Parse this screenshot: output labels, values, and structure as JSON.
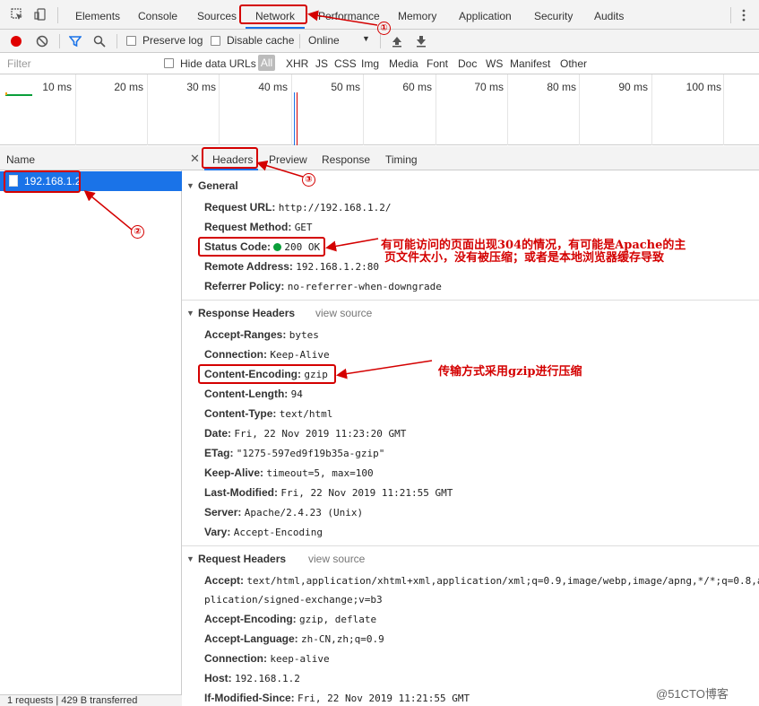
{
  "top_tabs": [
    "Elements",
    "Console",
    "Sources",
    "Network",
    "Performance",
    "Memory",
    "Application",
    "Security",
    "Audits"
  ],
  "toolbar": {
    "preserve_log": "Preserve log",
    "disable_cache": "Disable cache",
    "throttle": "Online"
  },
  "filter": {
    "placeholder": "Filter",
    "hide_data_urls": "Hide data URLs",
    "all": "All",
    "types": [
      "XHR",
      "JS",
      "CSS",
      "Img",
      "Media",
      "Font",
      "Doc",
      "WS",
      "Manifest",
      "Other"
    ]
  },
  "timeline": {
    "ticks": [
      "10 ms",
      "20 ms",
      "30 ms",
      "40 ms",
      "50 ms",
      "60 ms",
      "70 ms",
      "80 ms",
      "90 ms",
      "100 ms"
    ]
  },
  "requests": {
    "header": "Name",
    "items": [
      "192.168.1.2"
    ],
    "status": "1 requests | 429 B transferred"
  },
  "detail_tabs": [
    "Headers",
    "Preview",
    "Response",
    "Timing"
  ],
  "general": {
    "title": "General",
    "rows": [
      {
        "key": "Request URL:",
        "value": "http://192.168.1.2/"
      },
      {
        "key": "Request Method:",
        "value": "GET"
      },
      {
        "key": "Status Code:",
        "value": "200 OK"
      },
      {
        "key": "Remote Address:",
        "value": "192.168.1.2:80"
      },
      {
        "key": "Referrer Policy:",
        "value": "no-referrer-when-downgrade"
      }
    ]
  },
  "response_headers": {
    "title": "Response Headers",
    "view_source": "view source",
    "rows": [
      {
        "key": "Accept-Ranges:",
        "value": "bytes"
      },
      {
        "key": "Connection:",
        "value": "Keep-Alive"
      },
      {
        "key": "Content-Encoding:",
        "value": "gzip"
      },
      {
        "key": "Content-Length:",
        "value": "94"
      },
      {
        "key": "Content-Type:",
        "value": "text/html"
      },
      {
        "key": "Date:",
        "value": "Fri, 22 Nov 2019 11:23:20 GMT"
      },
      {
        "key": "ETag:",
        "value": "\"1275-597ed9f19b35a-gzip\""
      },
      {
        "key": "Keep-Alive:",
        "value": "timeout=5, max=100"
      },
      {
        "key": "Last-Modified:",
        "value": "Fri, 22 Nov 2019 11:21:55 GMT"
      },
      {
        "key": "Server:",
        "value": "Apache/2.4.23 (Unix)"
      },
      {
        "key": "Vary:",
        "value": "Accept-Encoding"
      }
    ]
  },
  "request_headers": {
    "title": "Request Headers",
    "view_source": "view source",
    "accept_key": "Accept:",
    "accept_value_1": "text/html,application/xhtml+xml,application/xml;q=0.9,image/webp,image/apng,*/*;q=0.8,a",
    "accept_value_2": "plication/signed-exchange;v=b3",
    "rows": [
      {
        "key": "Accept-Encoding:",
        "value": "gzip, deflate"
      },
      {
        "key": "Accept-Language:",
        "value": "zh-CN,zh;q=0.9"
      },
      {
        "key": "Connection:",
        "value": "keep-alive"
      },
      {
        "key": "Host:",
        "value": "192.168.1.2"
      },
      {
        "key": "If-Modified-Since:",
        "value": "Fri, 22 Nov 2019 11:21:55 GMT"
      }
    ]
  },
  "annotations": {
    "num1": "①",
    "num2": "②",
    "num3": "③",
    "status_note_line1": "有可能访问的页面出现304的情况，有可能是Apache的主",
    "status_note_line2": "页文件太小，没有被压缩；或者是本地浏览器缓存导致",
    "gzip_note": "传输方式采用gzip进行压缩"
  },
  "watermark": "@51CTO博客",
  "colors": {
    "accent": "#1a73e8",
    "annotation": "#d40000",
    "status_ok": "#0a9f3a",
    "record": "#e00000"
  }
}
